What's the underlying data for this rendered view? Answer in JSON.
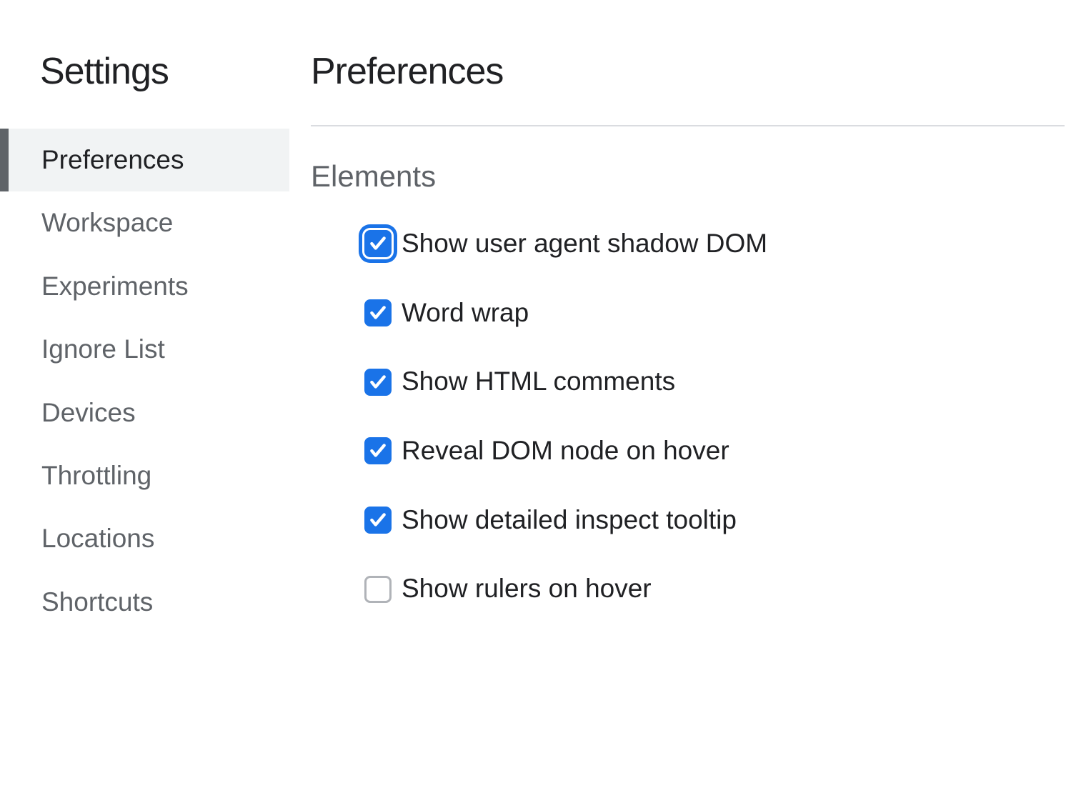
{
  "sidebar": {
    "title": "Settings",
    "items": [
      {
        "label": "Preferences",
        "active": true
      },
      {
        "label": "Workspace",
        "active": false
      },
      {
        "label": "Experiments",
        "active": false
      },
      {
        "label": "Ignore List",
        "active": false
      },
      {
        "label": "Devices",
        "active": false
      },
      {
        "label": "Throttling",
        "active": false
      },
      {
        "label": "Locations",
        "active": false
      },
      {
        "label": "Shortcuts",
        "active": false
      }
    ]
  },
  "main": {
    "title": "Preferences",
    "section_title": "Elements",
    "options": [
      {
        "label": "Show user agent shadow DOM",
        "checked": true,
        "focused": true
      },
      {
        "label": "Word wrap",
        "checked": true,
        "focused": false
      },
      {
        "label": "Show HTML comments",
        "checked": true,
        "focused": false
      },
      {
        "label": "Reveal DOM node on hover",
        "checked": true,
        "focused": false
      },
      {
        "label": "Show detailed inspect tooltip",
        "checked": true,
        "focused": false
      },
      {
        "label": "Show rulers on hover",
        "checked": false,
        "focused": false
      }
    ]
  }
}
